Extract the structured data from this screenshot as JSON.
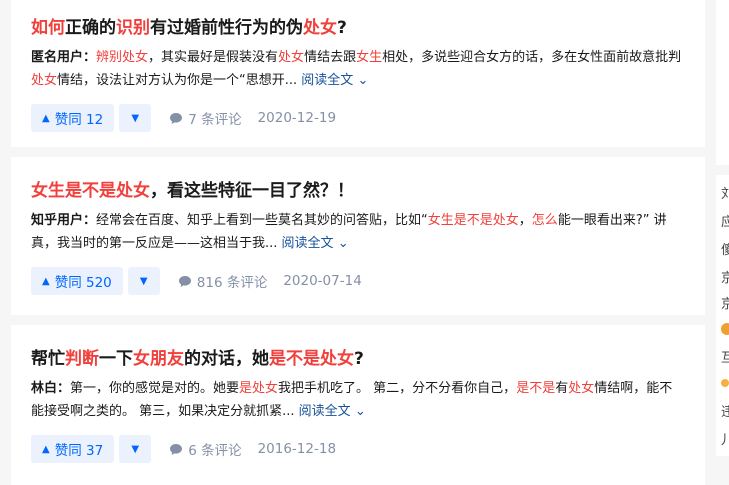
{
  "results": [
    {
      "title_parts": [
        {
          "text": "如何",
          "hl": true
        },
        {
          "text": "正确的",
          "hl": false
        },
        {
          "text": "识别",
          "hl": true
        },
        {
          "text": "有过婚前性行为的伪",
          "hl": false
        },
        {
          "text": "处女",
          "hl": true
        },
        {
          "text": "?",
          "hl": false
        }
      ],
      "author": "匿名用户：",
      "excerpt_parts": [
        {
          "text": "辨别处女",
          "hl": true
        },
        {
          "text": "，其实最好是假装没有",
          "hl": false
        },
        {
          "text": "处女",
          "hl": true
        },
        {
          "text": "情结去跟",
          "hl": false
        },
        {
          "text": "女生",
          "hl": true
        },
        {
          "text": "相处，多说些迎合女方的话，多在女性面前故意批判",
          "hl": false
        },
        {
          "text": "处女",
          "hl": true
        },
        {
          "text": "情结，设法让对方认为你是一个“思想开...",
          "hl": false
        }
      ],
      "read_more": "阅读全文",
      "upvote_label": "赞同 12",
      "comments": "7 条评论",
      "date": "2020-12-19"
    },
    {
      "title_parts": [
        {
          "text": "女生是不是处女",
          "hl": true
        },
        {
          "text": "，看这些特征一目了然？！",
          "hl": false
        }
      ],
      "author": "知乎用户：",
      "excerpt_parts": [
        {
          "text": "经常会在百度、知乎上看到一些莫名其妙的问答贴，比如“",
          "hl": false
        },
        {
          "text": "女生是不是处女",
          "hl": true
        },
        {
          "text": "，",
          "hl": false
        },
        {
          "text": "怎么",
          "hl": true
        },
        {
          "text": "能一眼看出来?” 讲真，我当时的第一反应是——这相当于我...",
          "hl": false
        }
      ],
      "read_more": "阅读全文",
      "upvote_label": "赞同 520",
      "comments": "816 条评论",
      "date": "2020-07-14"
    },
    {
      "title_parts": [
        {
          "text": "帮忙",
          "hl": false
        },
        {
          "text": "判断",
          "hl": true
        },
        {
          "text": "一下",
          "hl": false
        },
        {
          "text": "女朋友",
          "hl": true
        },
        {
          "text": "的对话，她",
          "hl": false
        },
        {
          "text": "是不是处女",
          "hl": true
        },
        {
          "text": "?",
          "hl": false
        }
      ],
      "author": "林白：",
      "excerpt_parts": [
        {
          "text": "第一，你的感觉是对的。她要",
          "hl": false
        },
        {
          "text": "是处女",
          "hl": true
        },
        {
          "text": "我把手机吃了。 第二，分不分看你自己，",
          "hl": false
        },
        {
          "text": "是不是",
          "hl": true
        },
        {
          "text": "有",
          "hl": false
        },
        {
          "text": "处女",
          "hl": true
        },
        {
          "text": "情结啊，能不能接受啊之类的。 第三，如果决定分就抓紧...",
          "hl": false
        }
      ],
      "read_more": "阅读全文",
      "upvote_label": "赞同 37",
      "comments": "6 条评论",
      "date": "2016-12-18"
    }
  ],
  "sidebar_chars": [
    "刘",
    "应",
    "傻",
    "京",
    "京",
    "互",
    "违",
    "儿"
  ],
  "colors": {
    "highlight": "#f1403c",
    "link": "#175199",
    "vote": "#0066ff",
    "muted": "#8590a6"
  }
}
